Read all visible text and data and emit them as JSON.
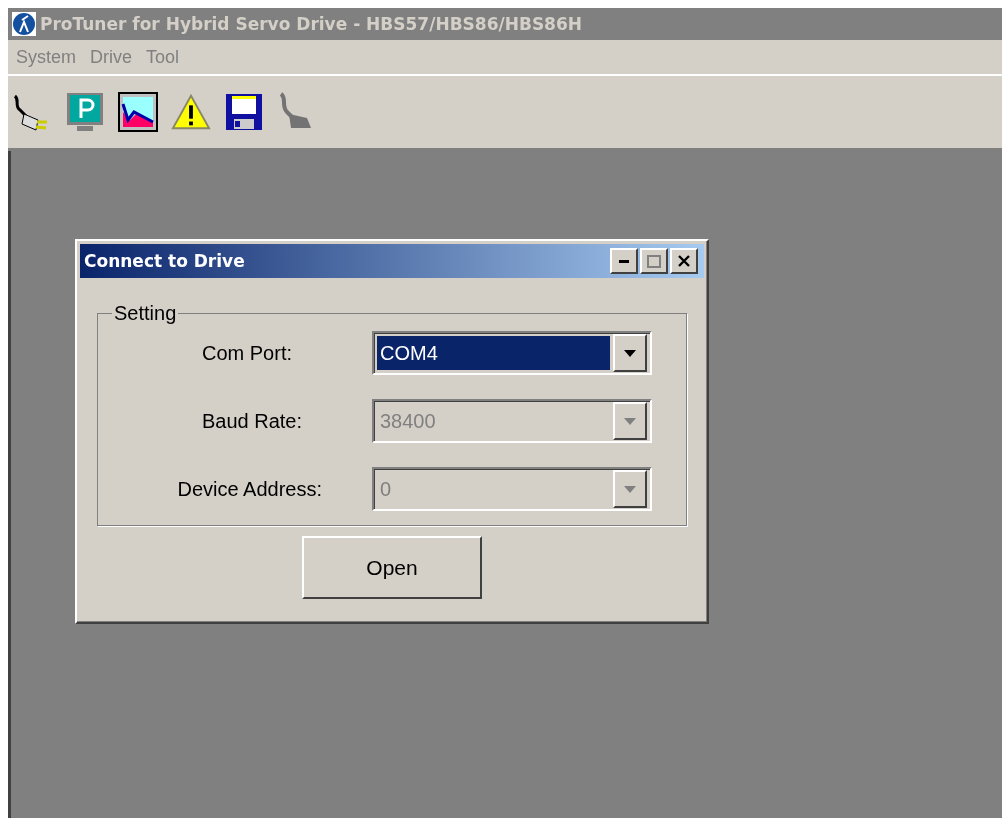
{
  "window": {
    "title": "ProTuner for Hybrid Servo Drive - HBS57/HBS86/HBS86H",
    "active": false
  },
  "menu": [
    {
      "label": "System"
    },
    {
      "label": "Drive"
    },
    {
      "label": "Tool"
    }
  ],
  "toolbar": [
    {
      "kind": "connect",
      "disabled": false
    },
    {
      "kind": "parameters",
      "disabled": false
    },
    {
      "kind": "scope",
      "disabled": false
    },
    {
      "kind": "alarm",
      "disabled": false
    },
    {
      "kind": "save",
      "disabled": false
    },
    {
      "kind": "disconnect",
      "disabled": true
    }
  ],
  "dialog": {
    "title": "Connect to Drive",
    "group": "Setting",
    "fields": [
      {
        "label": "Com Port:",
        "value": "COM4",
        "selected": true,
        "disabled": false
      },
      {
        "label": "Baud Rate:",
        "value": "38400",
        "selected": false,
        "disabled": true
      },
      {
        "label": "Device Address:",
        "value": "0",
        "selected": false,
        "disabled": true
      }
    ],
    "button": "Open"
  }
}
